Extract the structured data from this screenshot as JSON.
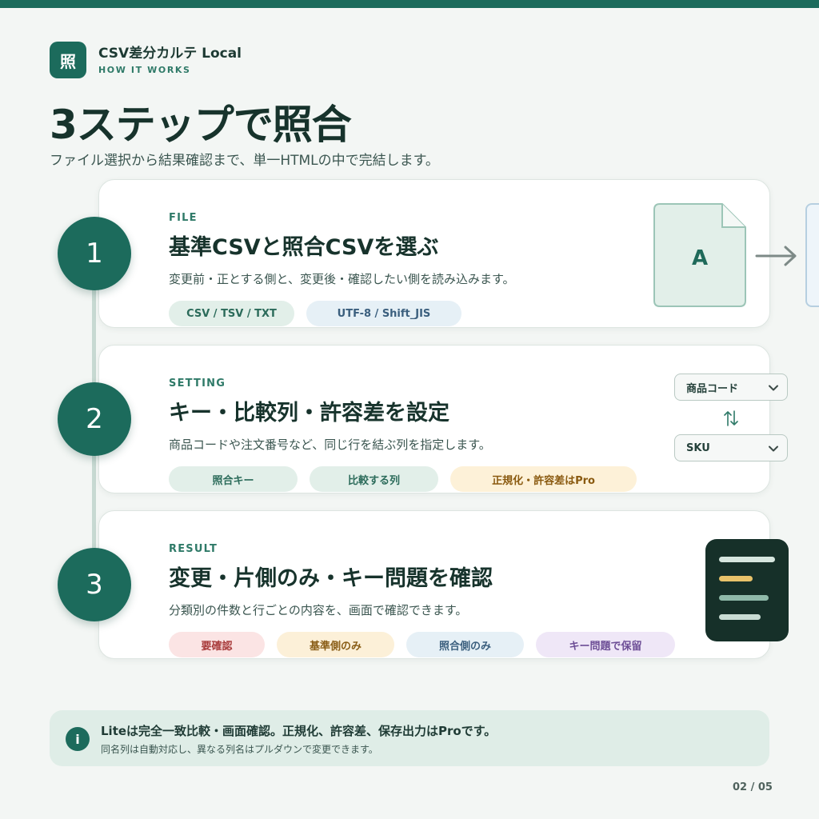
{
  "brand": {
    "logo_char": "照",
    "name": "CSV差分カルテ Local",
    "subtitle": "HOW IT WORKS"
  },
  "title": "3ステップで照合",
  "description": "ファイル選択から結果確認まで、単一HTMLの中で完結します。",
  "steps": [
    {
      "number": "1",
      "eyebrow": "FILE",
      "title": "基準CSVと照合CSVを選ぶ",
      "description": "変更前・正とする側と、変更後・確認したい側を読み込みます。",
      "chips": [
        "CSV / TSV / TXT",
        "UTF-8 / Shift_JIS"
      ]
    },
    {
      "number": "2",
      "eyebrow": "SETTING",
      "title": "キー・比較列・許容差を設定",
      "description": "商品コードや注文番号など、同じ行を結ぶ列を指定します。",
      "chips": [
        "照合キー",
        "比較する列",
        "正規化・許容差はPro"
      ]
    },
    {
      "number": "3",
      "eyebrow": "RESULT",
      "title": "変更・片側のみ・キー問題を確認",
      "description": "分類別の件数と行ごとの内容を、画面で確認できます。",
      "chips": [
        "要確認",
        "基準側のみ",
        "照合側のみ",
        "キー問題で保留"
      ]
    }
  ],
  "illustrations": {
    "file_letter": "A",
    "select_1": "商品コード",
    "select_2": "SKU"
  },
  "note": {
    "icon": "i",
    "main": "Liteは完全一致比較・画面確認。正規化、許容差、保存出力はProです。",
    "sub": "同名列は自動対応し、異なる列名はプルダウンで変更できます。"
  },
  "page_indicator": "02 / 05",
  "colors": {
    "accent": "#1c6b5c",
    "background": "#f3f6f4",
    "dark_panel": "#163029"
  }
}
